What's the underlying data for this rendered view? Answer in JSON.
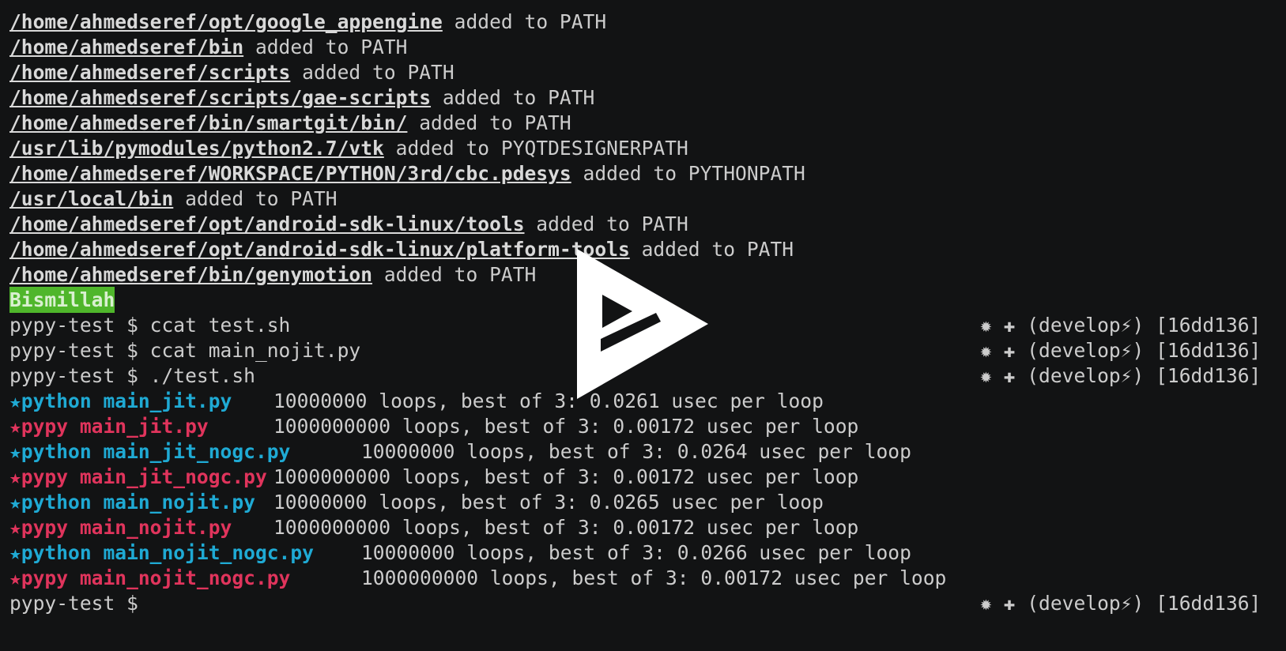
{
  "env_lines": [
    {
      "path": "/home/ahmedseref/opt/google_appengine",
      "rest": " added to PATH"
    },
    {
      "path": "/home/ahmedseref/bin",
      "rest": " added to PATH"
    },
    {
      "path": "/home/ahmedseref/scripts",
      "rest": " added to PATH"
    },
    {
      "path": "/home/ahmedseref/scripts/gae-scripts",
      "rest": " added to PATH"
    },
    {
      "path": "/home/ahmedseref/bin/smartgit/bin/",
      "rest": " added to PATH"
    },
    {
      "path": "/usr/lib/pymodules/python2.7/vtk",
      "rest": " added to PYQTDESIGNERPATH"
    },
    {
      "path": "/home/ahmedseref/WORKSPACE/PYTHON/3rd/cbc.pdesys",
      "rest": " added to PYTHONPATH"
    },
    {
      "path": "/usr/local/bin",
      "rest": " added to PATH"
    },
    {
      "path": "/home/ahmedseref/opt/android-sdk-linux/tools",
      "rest": " added to PATH"
    },
    {
      "path": "/home/ahmedseref/opt/android-sdk-linux/platform-tools",
      "rest": " added to PATH"
    },
    {
      "path": "/home/ahmedseref/bin/genymotion",
      "rest": " added to PATH"
    }
  ],
  "greeting": "Bismillah",
  "prompt": "pypy-test $",
  "git_status": "✹ ✚ (develop⚡) [16dd136]",
  "commands": [
    " ccat test.sh",
    " ccat main_nojit.py",
    " ./test.sh"
  ],
  "results": [
    {
      "label": "★python main_jit.py",
      "stats": "10000000 loops, best of 3: 0.0261 usec per loop",
      "col": 334
    },
    {
      "label": "★pypy main_jit.py",
      "stats": "1000000000 loops, best of 3: 0.00172 usec per loop",
      "col": 334
    },
    {
      "label": "★python main_jit_nogc.py",
      "stats": "10000000 loops, best of 3: 0.0264 usec per loop",
      "col": 445
    },
    {
      "label": "★pypy main_jit_nogc.py",
      "stats": "1000000000 loops, best of 3: 0.00172 usec per loop",
      "col": 334
    },
    {
      "label": "★python main_nojit.py",
      "stats": "10000000 loops, best of 3: 0.0265 usec per loop",
      "col": 334
    },
    {
      "label": "★pypy main_nojit.py",
      "stats": "1000000000 loops, best of 3: 0.00172 usec per loop",
      "col": 334
    },
    {
      "label": "★python main_nojit_nogc.py",
      "stats": "10000000 loops, best of 3: 0.0266 usec per loop",
      "col": 445
    },
    {
      "label": "★pypy main_nojit_nogc.py",
      "stats": "1000000000 loops, best of 3: 0.00172 usec per loop",
      "col": 445
    }
  ],
  "overlay": {
    "icon": "play-icon",
    "color": "#ffffff"
  }
}
